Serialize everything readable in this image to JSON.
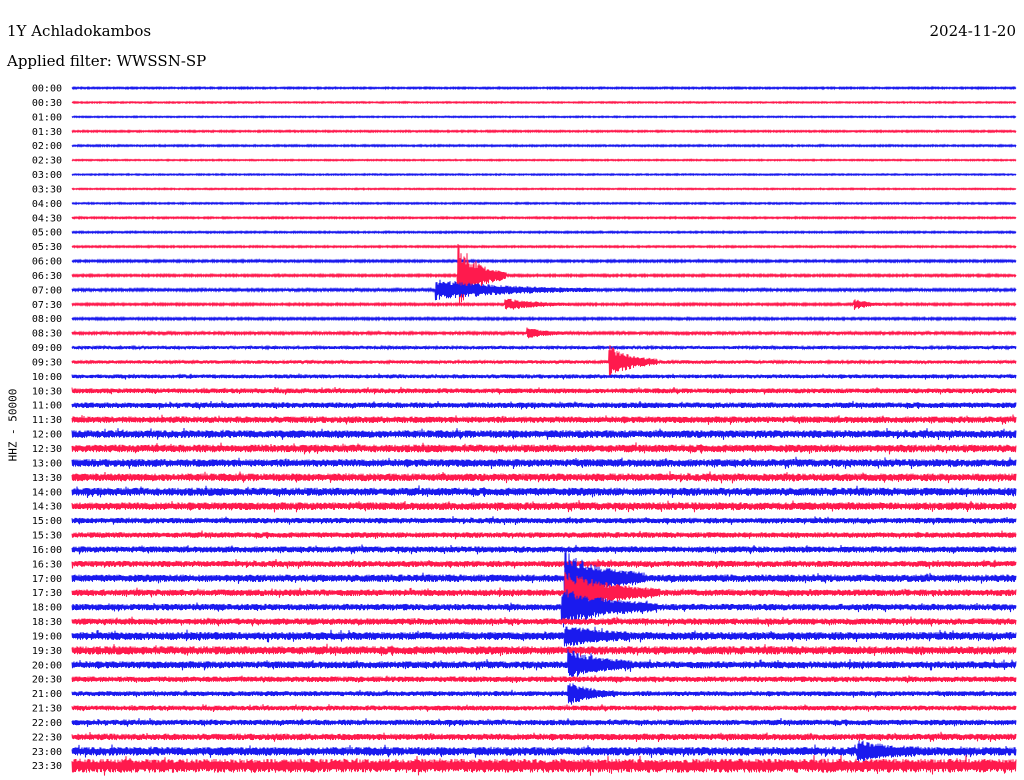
{
  "header": {
    "station": "1Y Achladokambos",
    "date": "2024-11-20",
    "filter": "Applied filter: WWSSN-SP"
  },
  "colors": {
    "blue": "#1a1aee",
    "red": "#ff1a4d"
  },
  "chart_data": {
    "type": "helicorder",
    "title": "1Y Achladokambos",
    "ylabel": "HHZ - 50000",
    "row_labels": [
      "00:00",
      "00:30",
      "01:00",
      "01:30",
      "02:00",
      "02:30",
      "03:00",
      "03:30",
      "04:00",
      "04:30",
      "05:00",
      "05:30",
      "06:00",
      "06:30",
      "07:00",
      "07:30",
      "08:00",
      "08:30",
      "09:00",
      "09:30",
      "10:00",
      "10:30",
      "11:00",
      "11:30",
      "12:00",
      "12:30",
      "13:00",
      "13:30",
      "14:00",
      "14:30",
      "15:00",
      "15:30",
      "16:00",
      "16:30",
      "17:00",
      "17:30",
      "18:00",
      "18:30",
      "19:00",
      "19:30",
      "20:00",
      "20:30",
      "21:00",
      "21:30",
      "22:00",
      "22:30",
      "23:00",
      "23:30"
    ],
    "trace_colors": "alternating blue/red starting with blue",
    "noise_level_relative": [
      1,
      0.8,
      0.8,
      1,
      1,
      0.8,
      0.8,
      0.8,
      0.9,
      1,
      1,
      1,
      1.3,
      1.3,
      1.5,
      1.3,
      1.3,
      1.6,
      2,
      2.2,
      2.6,
      3.2,
      3.6,
      4.2,
      5,
      5,
      5,
      5,
      5.2,
      5,
      3.6,
      3.6,
      4,
      4,
      4.8,
      4.2,
      4.2,
      4.2,
      5.2,
      5.4,
      4.6,
      3.6,
      3.2,
      3.2,
      3.6,
      4.2,
      5.6,
      9
    ],
    "events": [
      {
        "row": 13,
        "minute": 12.3,
        "amplitude_rel": 32,
        "duration_min": 1.5
      },
      {
        "row": 14,
        "minute": 11.6,
        "amplitude_rel": 10,
        "duration_min": 5
      },
      {
        "row": 15,
        "minute": 13.8,
        "amplitude_rel": 6,
        "duration_min": 2
      },
      {
        "row": 17,
        "minute": 14.5,
        "amplitude_rel": 5,
        "duration_min": 1.2
      },
      {
        "row": 19,
        "minute": 17.1,
        "amplitude_rel": 16,
        "duration_min": 1.5
      },
      {
        "row": 15,
        "minute": 24.9,
        "amplitude_rel": 5,
        "duration_min": 1
      },
      {
        "row": 34,
        "minute": 15.7,
        "amplitude_rel": 26,
        "duration_min": 2.5
      },
      {
        "row": 35,
        "minute": 15.7,
        "amplitude_rel": 20,
        "duration_min": 3
      },
      {
        "row": 36,
        "minute": 15.6,
        "amplitude_rel": 18,
        "duration_min": 3
      },
      {
        "row": 38,
        "minute": 15.7,
        "amplitude_rel": 10,
        "duration_min": 2
      },
      {
        "row": 40,
        "minute": 15.8,
        "amplitude_rel": 14,
        "duration_min": 2
      },
      {
        "row": 42,
        "minute": 15.8,
        "amplitude_rel": 10,
        "duration_min": 1.5
      },
      {
        "row": 46,
        "minute": 25.0,
        "amplitude_rel": 8,
        "duration_min": 2
      }
    ]
  }
}
